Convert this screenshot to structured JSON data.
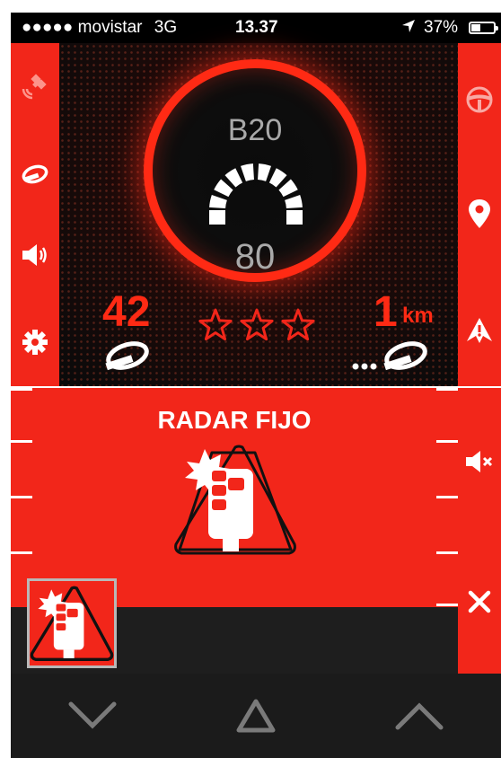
{
  "status_bar": {
    "signal": "●●●●●",
    "carrier": "movistar",
    "network": "3G",
    "time": "13.37",
    "battery": "37%"
  },
  "left_sidebar": {
    "icons": [
      "satellite-icon",
      "radar-gun-icon",
      "speaker-icon",
      "gear-icon"
    ]
  },
  "right_sidebar": {
    "icons": [
      "steering-wheel-icon",
      "map-pin-icon",
      "warning-arrow-icon"
    ]
  },
  "dashboard": {
    "road_name": "B20",
    "speed_limit": "80",
    "current_speed": "42",
    "distance_value": "1",
    "distance_unit": "km",
    "rating_stars": 3
  },
  "alert": {
    "title": "RADAR FIJO",
    "mute_icon": "mute-icon",
    "close_icon": "close-icon"
  },
  "bottom_nav": {
    "items": [
      "chevron-down-icon",
      "triangle-icon",
      "chevron-up-icon"
    ]
  },
  "colors": {
    "accent": "#f2261a",
    "dark": "#1b1b1b",
    "text_gray": "#a9a9a9"
  }
}
